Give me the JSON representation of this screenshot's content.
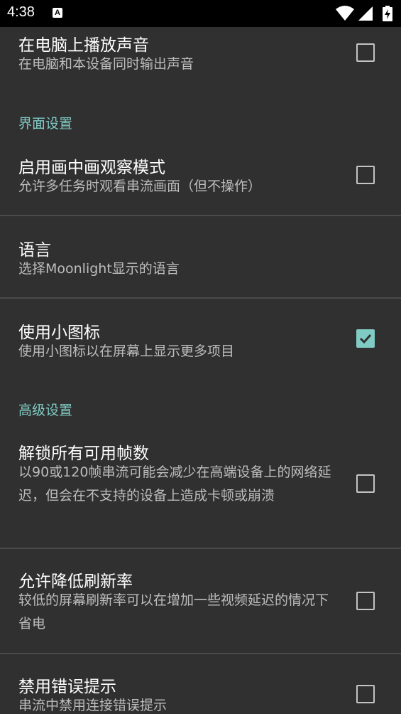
{
  "status_bar": {
    "time": "4:38",
    "notification_letter": "A"
  },
  "colors": {
    "accent": "#80cbc4",
    "background": "#303030",
    "title": "#ffffff",
    "summary": "#bdbdbd"
  },
  "preferences": [
    {
      "title": "在电脑上播放声音",
      "summary": "在电脑和本设备同时输出声音",
      "checked": false
    },
    {
      "category": "界面设置"
    },
    {
      "title": "启用画中画观察模式",
      "summary": "允许多任务时观看串流画面（但不操作）",
      "checked": false
    },
    {
      "title": "语言",
      "summary": "选择Moonlight显示的语言"
    },
    {
      "title": "使用小图标",
      "summary": "使用小图标以在屏幕上显示更多项目",
      "checked": true
    },
    {
      "category": "高级设置"
    },
    {
      "title": "解锁所有可用帧数",
      "summary": "以90或120帧串流可能会减少在高端设备上的网络延迟，但会在不支持的设备上造成卡顿或崩溃",
      "checked": false
    },
    {
      "title": "允许降低刷新率",
      "summary": "较低的屏幕刷新率可以在增加一些视频延迟的情况下省电",
      "checked": false
    },
    {
      "title": "禁用错误提示",
      "summary": "串流中禁用连接错误提示",
      "checked": false
    }
  ]
}
